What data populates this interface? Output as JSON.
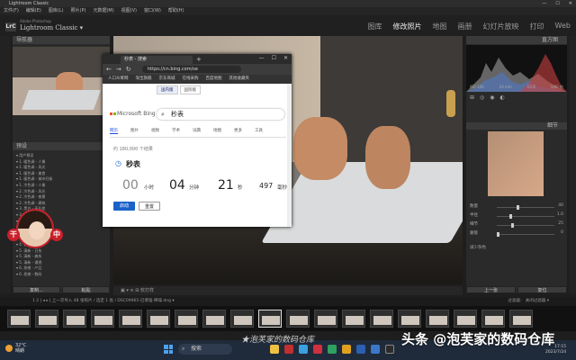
{
  "titlebar": {
    "title": "Lightroom Classic",
    "controls": [
      "—",
      "☐",
      "✕"
    ]
  },
  "menubar": [
    "文件(F)",
    "编辑(E)",
    "图库(L)",
    "照片(P)",
    "元数据(M)",
    "视图(V)",
    "窗口(W)",
    "帮助(H)"
  ],
  "identity": {
    "logo": "LrC",
    "brand": "Adobe Photoshop",
    "name": "Lightroom Classic ▾"
  },
  "modules": [
    "图库",
    "修改照片",
    "地图",
    "画册",
    "幻灯片放映",
    "打印",
    "Web"
  ],
  "left": {
    "navigator": "导航器",
    "presets_title": "预设",
    "presets": [
      "▾ 用户预设",
      "▾ 1. 暖色调 - 人像",
      "▾ 1. 暖色调 - 风光",
      "▾ 1. 暖色调 - 美食",
      "▾ 1. 暖色调 - 城市扫街",
      "▾ 1. 冷色调 - 人像",
      "▾ 2. 冷色调 - 风光",
      "▾ 2. 冷色调 - 夜景",
      "▾ 2. 冷色调 - 建筑",
      "▾ 3. 黑白 - 高反差",
      "▾ 3. 黑白 - 柔和",
      "▾ 3. 黑白 - 颗粒",
      "▾ 3. 黑白 - 人像",
      "▾ 4. 复古 - 胶片",
      "▾ 4. 复古 - 褪色",
      "▾ 4. 复古 - 日系",
      "▾ 5. 清新 - 日系",
      "▾ 5. 清新 - 森系",
      "▾ 5. 清新 - 通透",
      "▾ 6. 质感 - 产品",
      "▾ 6. 质感 - 数码"
    ],
    "copy_btn": "复制...",
    "paste_btn": "粘贴"
  },
  "browser": {
    "tab": "秒表 - 搜索",
    "url": "https://cn.bing.com/se",
    "favs": [
      "人口众筹网",
      "淘宝旗舰",
      "京东商城",
      "在线采购",
      "百度地图",
      "其他收藏夹"
    ],
    "toggle": [
      "国内版",
      "国际版"
    ],
    "logo": "Microsoft Bing",
    "query": "秒表",
    "tabs": [
      "网页",
      "图片",
      "视频",
      "学术",
      "词典",
      "地图",
      "更多",
      "工具"
    ],
    "count": "约 180,000 个结果",
    "widget_title": "秒表",
    "digits": [
      {
        "v": "00",
        "u": "小时"
      },
      {
        "v": "04",
        "u": "分钟"
      },
      {
        "v": "21",
        "u": "秒"
      },
      {
        "v": "497",
        "u": "毫秒"
      }
    ],
    "start": "启动",
    "reset": "重置"
  },
  "right": {
    "histogram": "直方图",
    "info": [
      "ISO 100",
      "24 mm",
      "f/2.8",
      "1/60 秒"
    ],
    "detail": "细节",
    "sliders": [
      {
        "label": "数量",
        "value": "40"
      },
      {
        "label": "半径",
        "value": "1.0"
      },
      {
        "label": "细节",
        "value": "25"
      },
      {
        "label": "蒙版",
        "value": "0"
      }
    ],
    "reduce_label": "减少杂色",
    "prev_btn": "上一张",
    "reset_btn": "复位"
  },
  "toolbar": {
    "text": "▣  ▾  ≡  ⊞ 软打样"
  },
  "filmstrip": {
    "header": "1  2  |  ◂ ▸  |  上一次导入  48 张照片 / 选定 1 张 / DSC09965-已增强-降噪.dng  ▾",
    "filter": "过滤器：  关闭过滤器 ▾",
    "count": 19,
    "selected": 9
  },
  "taskbar": {
    "temp": "32°C",
    "weather": "晴朗",
    "search": "搜索",
    "time": "17:15",
    "date": "2023/7/24"
  },
  "overlay": {
    "watermark": "★泡芙家的数码仓库",
    "brand": "头条 @泡芙家的数码仓库",
    "avatar_chars": [
      "干",
      "中"
    ]
  },
  "colors": {
    "bing_blue": "#174ae4",
    "lr_bg": "#1e1e1e",
    "accent_red": "#c8202a"
  }
}
